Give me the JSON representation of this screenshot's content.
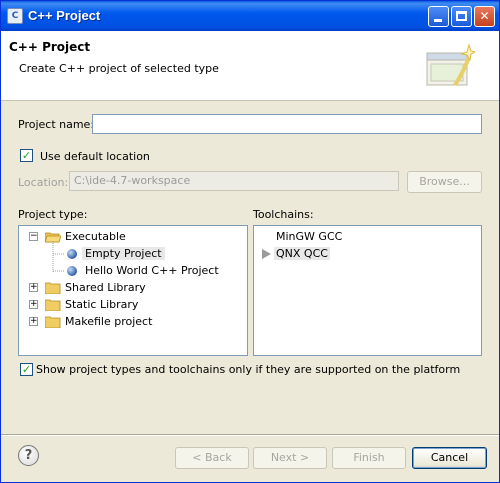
{
  "window": {
    "title": "C++ Project",
    "icon": "eclipse-c-icon"
  },
  "header": {
    "title": "C++ Project",
    "subtitle": "Create C++ project of selected type"
  },
  "form": {
    "project_name_label": "Project name:",
    "project_name_value": "",
    "use_default_label": "Use default location",
    "use_default_checked": true,
    "location_label": "Location:",
    "location_value": "C:\\ide-4.7-workspace",
    "browse_label": "Browse..."
  },
  "project_type": {
    "label": "Project type:",
    "items": [
      {
        "label": "Executable",
        "expanded": true,
        "icon": "folder-icon",
        "level": 0
      },
      {
        "label": "Empty Project",
        "icon": "project-ball-icon",
        "level": 1,
        "selected": true
      },
      {
        "label": "Hello World C++ Project",
        "icon": "project-ball-icon",
        "level": 1
      },
      {
        "label": "Shared Library",
        "expanded": false,
        "icon": "folder-icon",
        "level": 0
      },
      {
        "label": "Static Library",
        "expanded": false,
        "icon": "folder-icon",
        "level": 0
      },
      {
        "label": "Makefile project",
        "expanded": false,
        "icon": "folder-icon",
        "level": 0
      }
    ]
  },
  "toolchains": {
    "label": "Toolchains:",
    "items": [
      {
        "label": "MinGW GCC",
        "selected": false
      },
      {
        "label": "QNX QCC",
        "selected": true
      }
    ]
  },
  "filter": {
    "label": "Show project types and toolchains only if they are supported on the platform",
    "checked": true
  },
  "footer": {
    "back_label": "< Back",
    "next_label": "Next >",
    "finish_label": "Finish",
    "cancel_label": "Cancel"
  },
  "colors": {
    "title_bar": "#0058ee",
    "dialog_bg": "#ece9d8",
    "checkmark": "#21a121",
    "input_border": "#7f9db9"
  }
}
